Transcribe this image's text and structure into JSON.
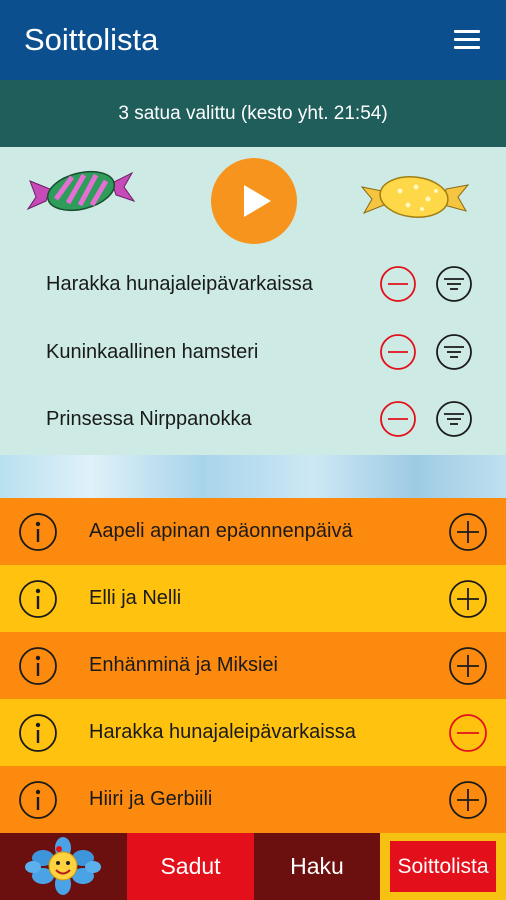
{
  "header": {
    "title": "Soittolista",
    "menu_icon": "hamburger-menu-icon"
  },
  "summary": {
    "text": "3 satua valittu (kesto yht. 21:54)"
  },
  "playlist": {
    "play_icon": "play-icon",
    "items": [
      {
        "title": "Harakka hunajaleipävarkaissa"
      },
      {
        "title": "Kuninkaallinen hamsteri"
      },
      {
        "title": "Prinsessa Nirppanokka"
      }
    ]
  },
  "catalog": {
    "items": [
      {
        "title": "Aapeli apinan epäonnenpäivä",
        "in_playlist": false,
        "color": "#fb8a0e"
      },
      {
        "title": "Elli ja Nelli",
        "in_playlist": false,
        "color": "#ffc20e"
      },
      {
        "title": "Enhänminä ja Miksiei",
        "in_playlist": false,
        "color": "#fb8a0e"
      },
      {
        "title": "Harakka hunajaleipävarkaissa",
        "in_playlist": true,
        "color": "#ffc20e"
      },
      {
        "title": "Hiiri ja Gerbiili",
        "in_playlist": false,
        "color": "#fb8a0e"
      }
    ]
  },
  "nav": {
    "home_icon": "flower-mascot-icon",
    "tabs": [
      {
        "label": "Sadut"
      },
      {
        "label": "Haku"
      },
      {
        "label": "Soittolista",
        "active": true
      }
    ]
  },
  "colors": {
    "header": "#0c4f8f",
    "summary": "#1f5e5a",
    "playlist_bg": "#cdeae5",
    "accent_orange": "#f7941d",
    "remove_red": "#e3101b",
    "nav_dark": "#6b0f0f"
  }
}
